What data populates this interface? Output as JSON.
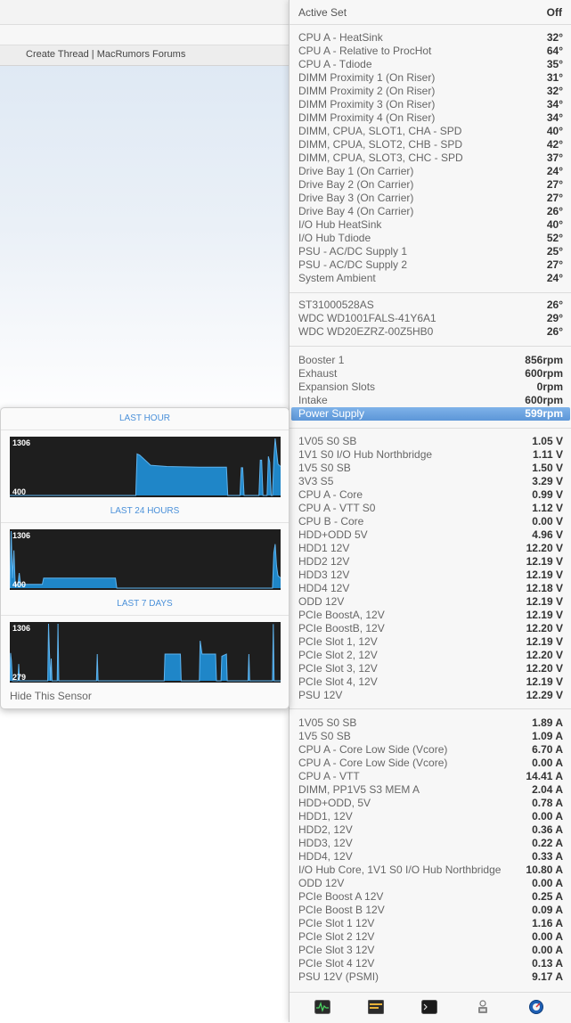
{
  "background_window": {
    "tab_title": "Create Thread | MacRumors Forums"
  },
  "active_set": {
    "label": "Active Set",
    "value": "Off"
  },
  "temperatures": [
    {
      "label": "CPU A - HeatSink",
      "value": "32°"
    },
    {
      "label": "CPU A - Relative to ProcHot",
      "value": "64°"
    },
    {
      "label": "CPU A - Tdiode",
      "value": "35°"
    },
    {
      "label": "DIMM Proximity 1 (On Riser)",
      "value": "31°"
    },
    {
      "label": "DIMM Proximity 2 (On Riser)",
      "value": "32°"
    },
    {
      "label": "DIMM Proximity 3 (On Riser)",
      "value": "34°"
    },
    {
      "label": "DIMM Proximity 4 (On Riser)",
      "value": "34°"
    },
    {
      "label": "DIMM, CPUA, SLOT1, CHA - SPD",
      "value": "40°"
    },
    {
      "label": "DIMM, CPUA, SLOT2, CHB - SPD",
      "value": "42°"
    },
    {
      "label": "DIMM, CPUA, SLOT3, CHC - SPD",
      "value": "37°"
    },
    {
      "label": "Drive Bay 1 (On Carrier)",
      "value": "24°"
    },
    {
      "label": "Drive Bay 2 (On Carrier)",
      "value": "27°"
    },
    {
      "label": "Drive Bay 3 (On Carrier)",
      "value": "27°"
    },
    {
      "label": "Drive Bay 4 (On Carrier)",
      "value": "26°"
    },
    {
      "label": "I/O Hub HeatSink",
      "value": "40°"
    },
    {
      "label": "I/O Hub Tdiode",
      "value": "52°"
    },
    {
      "label": "PSU - AC/DC Supply 1",
      "value": "25°"
    },
    {
      "label": "PSU - AC/DC Supply 2",
      "value": "27°"
    },
    {
      "label": "System Ambient",
      "value": "24°"
    }
  ],
  "drives": [
    {
      "label": "ST31000528AS",
      "value": "26°"
    },
    {
      "label": "WDC WD1001FALS-41Y6A1",
      "value": "29°"
    },
    {
      "label": "WDC WD20EZRZ-00Z5HB0",
      "value": "26°"
    }
  ],
  "fans": [
    {
      "label": "Booster 1",
      "value": "856rpm"
    },
    {
      "label": "Exhaust",
      "value": "600rpm"
    },
    {
      "label": "Expansion Slots",
      "value": "0rpm"
    },
    {
      "label": "Intake",
      "value": "600rpm"
    },
    {
      "label": "Power Supply",
      "value": "599rpm",
      "selected": true
    }
  ],
  "voltages": [
    {
      "label": "1V05 S0 SB",
      "value": "1.05 V"
    },
    {
      "label": "1V1 S0 I/O Hub Northbridge",
      "value": "1.11 V"
    },
    {
      "label": "1V5 S0 SB",
      "value": "1.50 V"
    },
    {
      "label": "3V3 S5",
      "value": "3.29 V"
    },
    {
      "label": "CPU A - Core",
      "value": "0.99 V"
    },
    {
      "label": "CPU A - VTT S0",
      "value": "1.12 V"
    },
    {
      "label": "CPU B - Core",
      "value": "0.00 V"
    },
    {
      "label": "HDD+ODD 5V",
      "value": "4.96 V"
    },
    {
      "label": "HDD1 12V",
      "value": "12.20 V"
    },
    {
      "label": "HDD2 12V",
      "value": "12.19 V"
    },
    {
      "label": "HDD3 12V",
      "value": "12.19 V"
    },
    {
      "label": "HDD4 12V",
      "value": "12.18 V"
    },
    {
      "label": "ODD 12V",
      "value": "12.19 V"
    },
    {
      "label": "PCIe BoostA, 12V",
      "value": "12.19 V"
    },
    {
      "label": "PCIe BoostB, 12V",
      "value": "12.20 V"
    },
    {
      "label": "PCIe Slot 1, 12V",
      "value": "12.19 V"
    },
    {
      "label": "PCIe Slot 2, 12V",
      "value": "12.20 V"
    },
    {
      "label": "PCIe Slot 3, 12V",
      "value": "12.20 V"
    },
    {
      "label": "PCIe Slot 4, 12V",
      "value": "12.19 V"
    },
    {
      "label": "PSU 12V",
      "value": "12.29 V"
    }
  ],
  "currents": [
    {
      "label": "1V05 S0 SB",
      "value": "1.89 A"
    },
    {
      "label": "1V5 S0 SB",
      "value": "1.09 A"
    },
    {
      "label": "CPU A - Core Low Side (Vcore)",
      "value": "6.70 A"
    },
    {
      "label": "CPU A - Core Low Side (Vcore)",
      "value": "0.00 A"
    },
    {
      "label": "CPU A - VTT",
      "value": "14.41 A"
    },
    {
      "label": "DIMM, PP1V5 S3 MEM A",
      "value": "2.04 A"
    },
    {
      "label": "HDD+ODD, 5V",
      "value": "0.78 A"
    },
    {
      "label": "HDD1, 12V",
      "value": "0.00 A"
    },
    {
      "label": "HDD2, 12V",
      "value": "0.36 A"
    },
    {
      "label": "HDD3, 12V",
      "value": "0.22 A"
    },
    {
      "label": "HDD4, 12V",
      "value": "0.33 A"
    },
    {
      "label": "I/O Hub Core, 1V1 S0 I/O Hub Northbridge",
      "value": "10.80 A"
    },
    {
      "label": "ODD 12V",
      "value": "0.00 A"
    },
    {
      "label": "PCIe Boost A 12V",
      "value": "0.25 A"
    },
    {
      "label": "PCIe Boost B 12V",
      "value": "0.09 A"
    },
    {
      "label": "PCIe Slot 1 12V",
      "value": "1.16 A"
    },
    {
      "label": "PCIe Slot 2 12V",
      "value": "0.00 A"
    },
    {
      "label": "PCIe Slot 3 12V",
      "value": "0.00 A"
    },
    {
      "label": "PCIe Slot 4 12V",
      "value": "0.13 A"
    },
    {
      "label": "PSU 12V (PSMI)",
      "value": "9.17 A"
    }
  ],
  "history": {
    "hide_label": "Hide This Sensor",
    "accent_color": "#1f86c8",
    "periods": [
      {
        "title": "LAST HOUR",
        "max_label": "1306",
        "min_label": "400",
        "ymin": 400,
        "ymax": 1306,
        "points": [
          [
            0,
            400
          ],
          [
            46,
            400
          ],
          [
            46.5,
            400
          ],
          [
            47,
            1060
          ],
          [
            48,
            1040
          ],
          [
            52,
            880
          ],
          [
            58,
            860
          ],
          [
            70,
            850
          ],
          [
            80,
            850
          ],
          [
            80.5,
            400
          ],
          [
            85,
            400
          ],
          [
            85.5,
            840
          ],
          [
            86,
            840
          ],
          [
            86.5,
            400
          ],
          [
            92,
            400
          ],
          [
            92.5,
            960
          ],
          [
            93,
            960
          ],
          [
            93.5,
            400
          ],
          [
            95,
            400
          ],
          [
            95.5,
            1020
          ],
          [
            96,
            930
          ],
          [
            96.5,
            400
          ],
          [
            97,
            400
          ],
          [
            97.5,
            980
          ],
          [
            98,
            1306
          ],
          [
            99,
            900
          ],
          [
            100,
            860
          ]
        ]
      },
      {
        "title": "LAST 24 HOURS",
        "max_label": "1306",
        "min_label": "400",
        "ymin": 400,
        "ymax": 1306,
        "points": [
          [
            0,
            400
          ],
          [
            0.5,
            1306
          ],
          [
            1,
            560
          ],
          [
            1.5,
            1000
          ],
          [
            2,
            460
          ],
          [
            3,
            460
          ],
          [
            3.5,
            640
          ],
          [
            4,
            460
          ],
          [
            12,
            460
          ],
          [
            12.5,
            560
          ],
          [
            25,
            560
          ],
          [
            25.5,
            560
          ],
          [
            37,
            560
          ],
          [
            37.5,
            560
          ],
          [
            39,
            560
          ],
          [
            39.5,
            400
          ],
          [
            97,
            400
          ],
          [
            97.5,
            960
          ],
          [
            98,
            1100
          ],
          [
            98.5,
            760
          ],
          [
            99,
            600
          ],
          [
            100,
            560
          ]
        ]
      },
      {
        "title": "LAST 7 DAYS",
        "max_label": "1306",
        "min_label": "279",
        "ymin": 279,
        "ymax": 1306,
        "points": [
          [
            0,
            279
          ],
          [
            0.3,
            780
          ],
          [
            0.6,
            640
          ],
          [
            1,
            279
          ],
          [
            3,
            279
          ],
          [
            3.3,
            580
          ],
          [
            3.6,
            279
          ],
          [
            14,
            279
          ],
          [
            14.3,
            1306
          ],
          [
            14.6,
            840
          ],
          [
            15,
            279
          ],
          [
            15.3,
            680
          ],
          [
            15.6,
            279
          ],
          [
            17.5,
            279
          ],
          [
            17.8,
            1306
          ],
          [
            18.1,
            279
          ],
          [
            32,
            279
          ],
          [
            32.3,
            760
          ],
          [
            32.6,
            279
          ],
          [
            57,
            279
          ],
          [
            57.3,
            760
          ],
          [
            63,
            760
          ],
          [
            63.3,
            279
          ],
          [
            70,
            279
          ],
          [
            70.3,
            1000
          ],
          [
            71,
            760
          ],
          [
            76,
            760
          ],
          [
            76.3,
            279
          ],
          [
            78,
            279
          ],
          [
            78.3,
            720
          ],
          [
            80,
            760
          ],
          [
            80.3,
            279
          ],
          [
            88,
            279
          ],
          [
            88.3,
            760
          ],
          [
            88.6,
            279
          ],
          [
            97,
            279
          ],
          [
            97.3,
            1300
          ],
          [
            97.6,
            279
          ],
          [
            100,
            279
          ]
        ]
      }
    ]
  },
  "toolbar_icons": [
    "activity-monitor-icon",
    "console-log-icon",
    "terminal-icon",
    "script-editor-icon",
    "disk-utility-icon"
  ]
}
